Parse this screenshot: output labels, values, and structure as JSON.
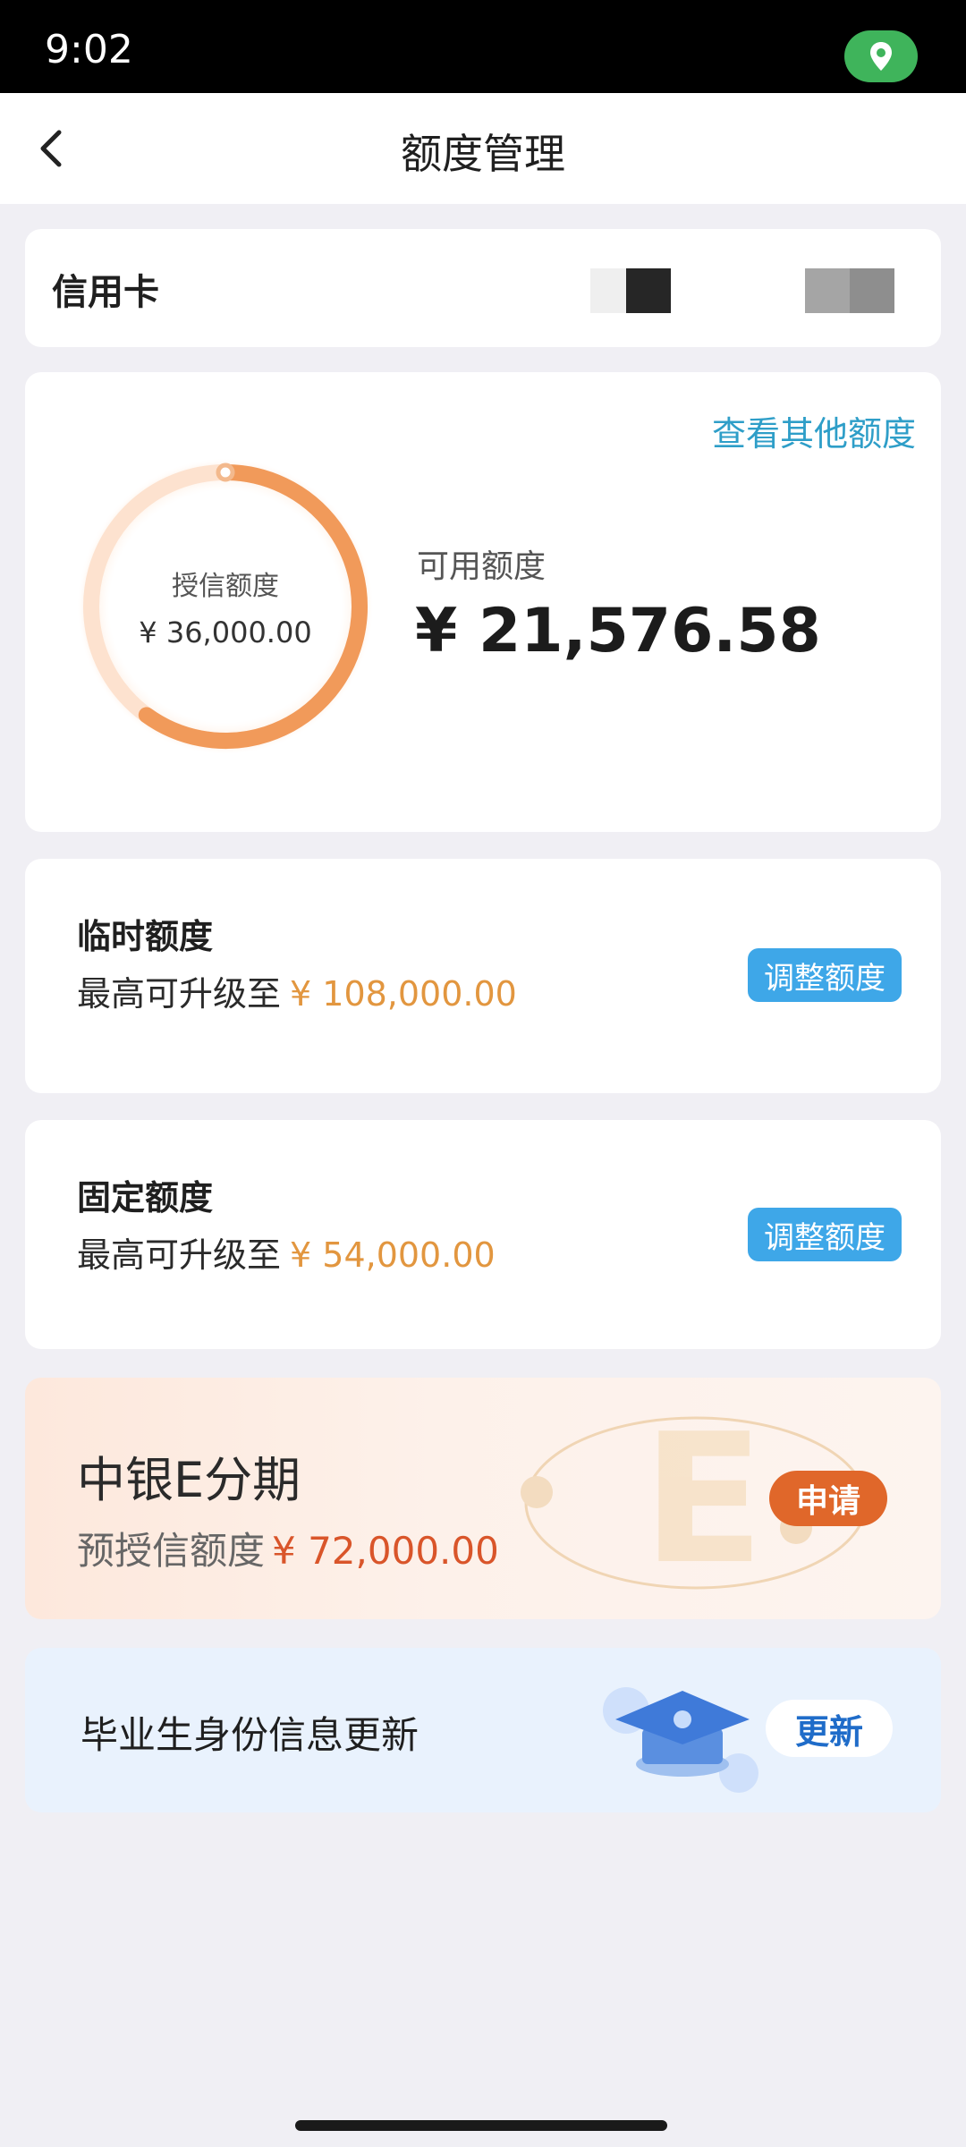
{
  "status_bar": {
    "time": "9:02",
    "location_icon": "location-pin-icon"
  },
  "nav": {
    "title": "额度管理",
    "back_icon": "chevron-left-icon"
  },
  "card_type": {
    "label": "信用卡"
  },
  "credit": {
    "other_link": "查看其他额度",
    "ring_label": "授信额度",
    "ring_amount": "¥ 36,000.00",
    "available_label": "可用额度",
    "available_amount": "¥ 21,576.58",
    "available_fraction": 0.6
  },
  "temporary": {
    "title": "临时额度",
    "desc_prefix": "最高可升级至",
    "amount": "¥ 108,000.00",
    "button": "调整额度"
  },
  "fixed": {
    "title": "固定额度",
    "desc_prefix": "最高可升级至",
    "amount": "¥ 54,000.00",
    "button": "调整额度"
  },
  "installment": {
    "title": "中银E分期",
    "desc_prefix": "预授信额度",
    "amount": "¥ 72,000.00",
    "button": "申请"
  },
  "graduate": {
    "title": "毕业生身份信息更新",
    "button": "更新"
  },
  "colors": {
    "accent_blue": "#3ea7e8",
    "amount_orange": "#e2963f",
    "apply_orange": "#e0672a",
    "link_blue": "#2e9ec8"
  }
}
